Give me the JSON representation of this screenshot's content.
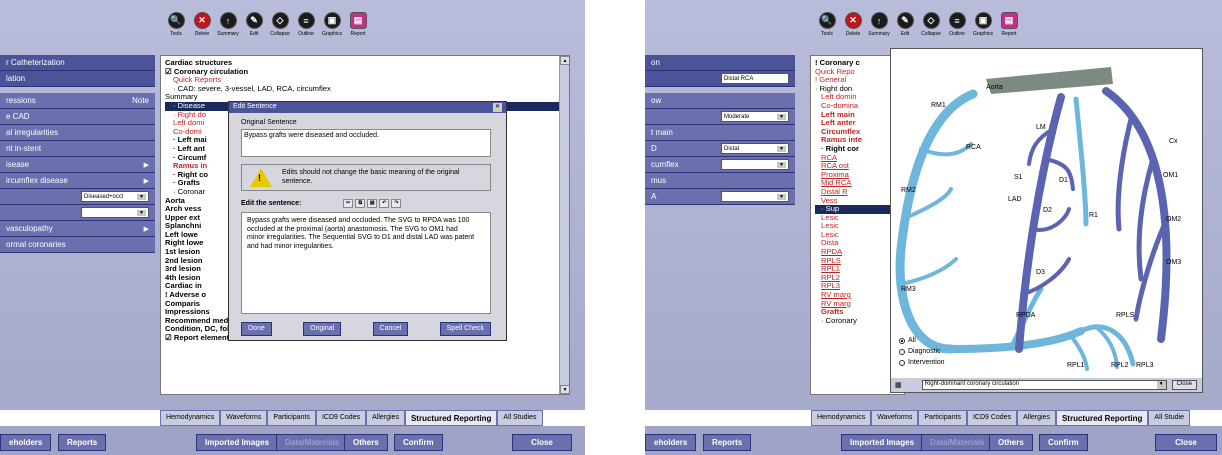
{
  "toolbar": {
    "items": [
      {
        "label": "Tools",
        "icon": "search-icon"
      },
      {
        "label": "Delete",
        "icon": "delete-icon"
      },
      {
        "label": "Summary",
        "icon": "summary-icon"
      },
      {
        "label": "Edit",
        "icon": "edit-icon"
      },
      {
        "label": "Collapse",
        "icon": "collapse-icon"
      },
      {
        "label": "Outline",
        "icon": "outline-icon"
      },
      {
        "label": "Graphics",
        "icon": "graphics-icon"
      },
      {
        "label": "Report",
        "icon": "report-icon"
      }
    ]
  },
  "left": {
    "nav": [
      "r Catheterization",
      "lation",
      "ressions",
      "e CAD",
      "al irregularities",
      "nt in-stent",
      "isease",
      "ircumflex disease",
      "",
      "",
      "vasculopathy",
      "ormal coronaries"
    ],
    "note": "Note",
    "select1": "Diseased+occl",
    "tree": [
      {
        "t": "Cardiac structures",
        "c": "b"
      },
      {
        "t": "☑ Coronary circulation",
        "c": "b"
      },
      {
        "t": "Quick Reports",
        "c": "r",
        "i": 1
      },
      {
        "t": "· CAD: severe, 3-vessel, LAD, RCA, circumflex",
        "c": "",
        "i": 1
      },
      {
        "t": "Summary",
        "c": ""
      },
      {
        "t": "· Disease",
        "c": "hl",
        "i": 1
      },
      {
        "t": "· Right do",
        "c": "r",
        "i": 1
      },
      {
        "t": "Left domi",
        "c": "r",
        "i": 1
      },
      {
        "t": "Co-domi",
        "c": "r",
        "i": 1
      },
      {
        "t": "· Left mai",
        "c": "b",
        "i": 1
      },
      {
        "t": "· Left ant",
        "c": "b",
        "i": 1
      },
      {
        "t": "· Circumf",
        "c": "b",
        "i": 1
      },
      {
        "t": "Ramus in",
        "c": "r b",
        "i": 1
      },
      {
        "t": "· Right co",
        "c": "b",
        "i": 1
      },
      {
        "t": "· Grafts",
        "c": "b",
        "i": 1
      },
      {
        "t": "· Coronar",
        "c": "",
        "i": 1
      },
      {
        "t": "Aorta",
        "c": "b"
      },
      {
        "t": "Arch vess",
        "c": "b"
      },
      {
        "t": "Upper ext",
        "c": "b"
      },
      {
        "t": "Splanchni",
        "c": "b"
      },
      {
        "t": "Left lowe",
        "c": "b"
      },
      {
        "t": "Right lowe",
        "c": "b"
      },
      {
        "t": "1st lesion",
        "c": "b"
      },
      {
        "t": "2nd lesion",
        "c": "b"
      },
      {
        "t": "3rd lesion",
        "c": "b"
      },
      {
        "t": "4th lesion",
        "c": "b"
      },
      {
        "t": "Cardiac in",
        "c": "b"
      },
      {
        "t": "! Adverse o",
        "c": "b"
      },
      {
        "t": "Comparis",
        "c": "b"
      },
      {
        "t": "Impressions",
        "c": "b"
      },
      {
        "t": "Recommend meds, tests, consult",
        "c": "b"
      },
      {
        "t": "Condition, DC, follow up",
        "c": "b"
      },
      {
        "t": "☑ Report element selection",
        "c": "b"
      }
    ],
    "dialog": {
      "title": "Edit Sentence",
      "orig_label": "Original Sentence",
      "orig": "Bypass grafts were diseased and occluded.",
      "warn": "Edits should not change the basic meaning of the original sentence.",
      "edit_label": "Edit the sentence:",
      "edit": "Bypass grafts were diseased and occluded. The SVG to RPDA was 100 occluded at the proximal (aorta) anastomosis. The SVG to OM1 had minor irregularities. The Sequential SVG to D1 and distal LAD was patent and had minor irregularities.",
      "buttons": [
        "Done",
        "Original",
        "Cancel",
        "Spell Check"
      ]
    },
    "tabs": [
      "Hemodynamics",
      "Waveforms",
      "Participants",
      "ICD9 Codes",
      "Allergies",
      "Structured Reporting",
      "All Studies"
    ],
    "bottom": [
      "eholders",
      "Reports",
      "Imported Images",
      "Data/Materials",
      "Others",
      "Confirm",
      "Close"
    ]
  },
  "right": {
    "nav": [
      "on",
      "",
      "ow",
      "",
      "t main",
      "D",
      "cumflex",
      "mus",
      "A"
    ],
    "selects": [
      "Distal RCA",
      "Moderate",
      "Distal",
      ""
    ],
    "tree": [
      {
        "t": "! Coronary c",
        "c": "b"
      },
      {
        "t": "Quick Repo",
        "c": "r"
      },
      {
        "t": "! General",
        "c": "r"
      },
      {
        "t": "· Right don",
        "c": ""
      },
      {
        "t": "Left domin",
        "c": "r"
      },
      {
        "t": "Co-domina",
        "c": "r"
      },
      {
        "t": "Left main",
        "c": "r b"
      },
      {
        "t": "Left anter",
        "c": "r b"
      },
      {
        "t": "Circumflex",
        "c": "r b"
      },
      {
        "t": "Ramus inte",
        "c": "r b"
      },
      {
        "t": "· Right cor",
        "c": "b"
      },
      {
        "t": "RCA",
        "c": "u"
      },
      {
        "t": "RCA ost",
        "c": "u"
      },
      {
        "t": "Proxima",
        "c": "u"
      },
      {
        "t": "Mid RCA",
        "c": "u"
      },
      {
        "t": "Distal R",
        "c": "u"
      },
      {
        "t": "Vess",
        "c": "r"
      },
      {
        "t": "· Sup",
        "c": "hl"
      },
      {
        "t": "Lesic",
        "c": "r"
      },
      {
        "t": "Lesic",
        "c": "r"
      },
      {
        "t": "Lesic",
        "c": "r"
      },
      {
        "t": "Dista",
        "c": "r"
      },
      {
        "t": "RPDA",
        "c": "u"
      },
      {
        "t": "RPLS",
        "c": "u"
      },
      {
        "t": "RPL1",
        "c": "u"
      },
      {
        "t": "RPL2",
        "c": "u"
      },
      {
        "t": "RPL3",
        "c": "u"
      },
      {
        "t": "RV marg",
        "c": "u"
      },
      {
        "t": "RV marg",
        "c": "u"
      },
      {
        "t": "Grafts",
        "c": "r b"
      },
      {
        "t": "· Coronary",
        "c": ""
      }
    ],
    "diagram": {
      "labels": [
        "Aorta",
        "RM1",
        "LM",
        "Cx",
        "RCA",
        "S1",
        "D1",
        "OM1",
        "RM2",
        "LAD",
        "D2",
        "R1",
        "OM2",
        "D3",
        "OM3",
        "RM3",
        "RPDA",
        "RPLS",
        "RPL1",
        "RPL2",
        "RPL3"
      ],
      "radios": [
        "All",
        "Diagnostic",
        "Intervention"
      ],
      "selected_radio": "All",
      "select": "Right-dominant coronary circulation",
      "close": "Close"
    },
    "tabs": [
      "Hemodynamics",
      "Waveforms",
      "Participants",
      "ICD9 Codes",
      "Allergies",
      "Structured Reporting",
      "All Studie"
    ],
    "bottom": [
      "eholders",
      "Reports",
      "Imported Images",
      "Data/Materials",
      "Others",
      "Confirm",
      "Close"
    ]
  },
  "colors": {
    "nav": "#4c5499",
    "vessel_light": "#6fb6dc",
    "vessel_dark": "#5a64b0"
  }
}
